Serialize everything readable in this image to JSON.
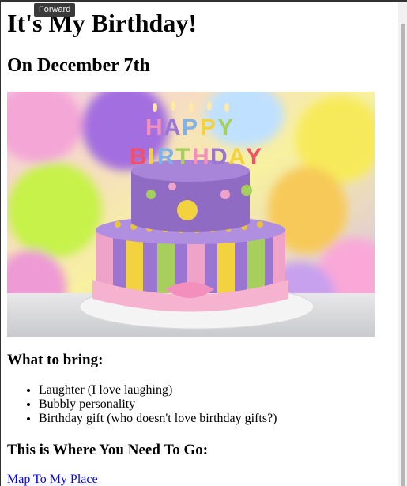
{
  "tooltip": {
    "text": "Forward"
  },
  "page": {
    "title": "It's My Birthday!",
    "subtitle": "On December 7th",
    "image": {
      "description_icon": "birthday-cake-image"
    },
    "bring_heading": "What to bring:",
    "bring_items": [
      "Laughter (I love laughing)",
      "Bubbly personality",
      "Birthday gift (who doesn't love birthday gifts?)"
    ],
    "go_heading": "This is Where You Need To Go:",
    "map_link": "Map To My Place"
  },
  "colors": {
    "link": "#0000ee",
    "cake_purple": "#8f6bc4",
    "cake_yellow": "#f3d23f",
    "cake_pink": "#f0a3c8",
    "cake_green": "#a6cf5c"
  }
}
